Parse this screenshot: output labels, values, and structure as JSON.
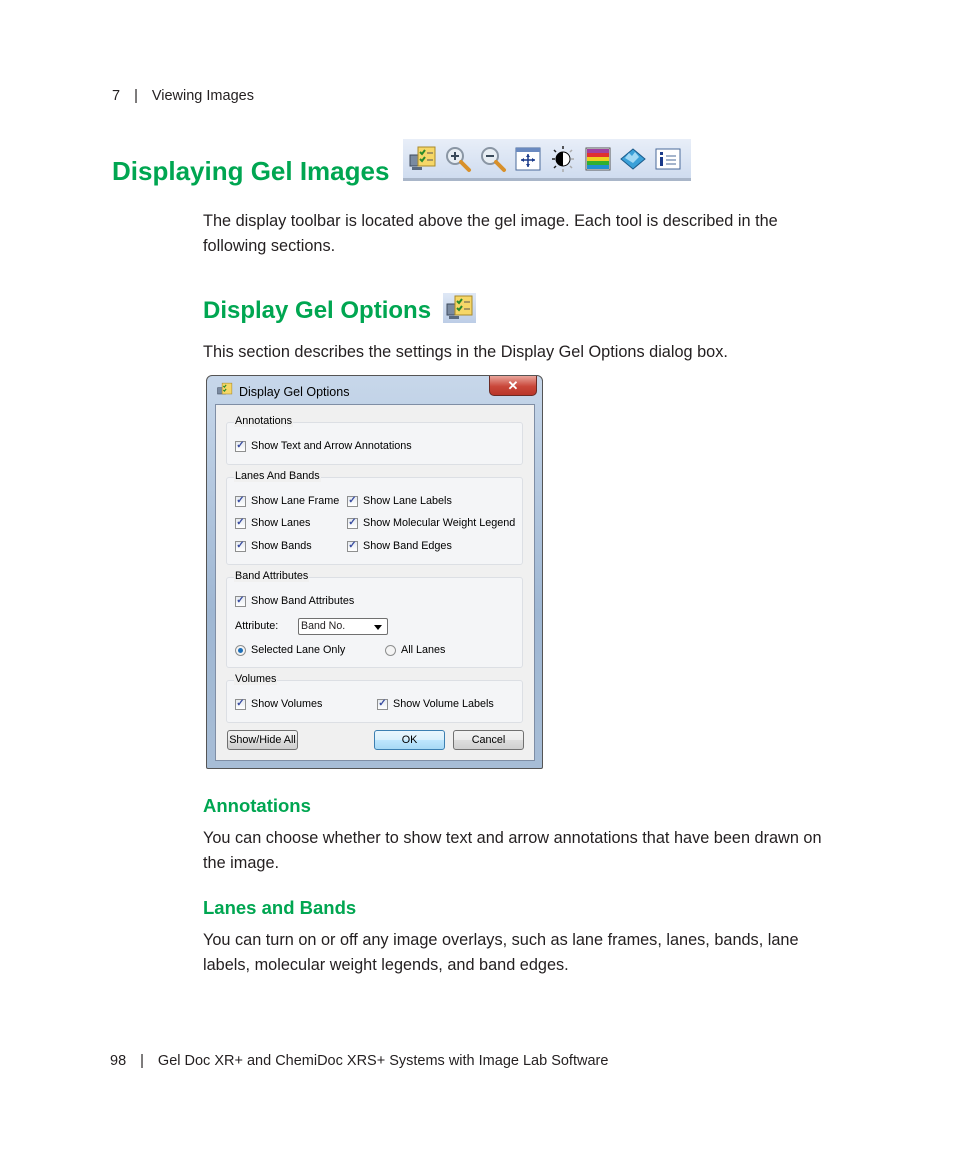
{
  "header": {
    "chapter_number": "7",
    "separator": "|",
    "chapter_title": "Viewing Images"
  },
  "section": {
    "title": "Displaying Gel Images",
    "toolbar_icons": [
      "display-gel-options-icon",
      "zoom-in-icon",
      "zoom-out-icon",
      "fit-in-window-icon",
      "image-transform-icon",
      "color-palette-icon",
      "3d-viewer-icon",
      "image-info-icon"
    ],
    "intro": "The display toolbar is located above the gel image. Each tool is described in the following sections."
  },
  "subsection": {
    "title": "Display Gel Options",
    "icon": "display-gel-options-icon",
    "intro": "This section describes the settings in the Display Gel Options dialog box."
  },
  "dialog": {
    "title": "Display Gel Options",
    "close_label": "✕",
    "groups": {
      "annotations": {
        "label": "Annotations",
        "items": [
          {
            "label": "Show Text and Arrow Annotations",
            "checked": true
          }
        ]
      },
      "lanes_and_bands": {
        "label": "Lanes And Bands",
        "items": [
          {
            "label": "Show Lane Frame",
            "checked": true
          },
          {
            "label": "Show Lane Labels",
            "checked": true
          },
          {
            "label": "Show Lanes",
            "checked": true
          },
          {
            "label": "Show Molecular Weight Legend",
            "checked": true
          },
          {
            "label": "Show Bands",
            "checked": true
          },
          {
            "label": "Show Band Edges",
            "checked": true
          }
        ]
      },
      "band_attributes": {
        "label": "Band Attributes",
        "show_label": "Show Band Attributes",
        "show_checked": true,
        "attribute_label": "Attribute:",
        "attribute_value": "Band No.",
        "radio_selected_lane": "Selected Lane Only",
        "radio_all_lanes": "All Lanes",
        "selected_radio": "Selected Lane Only"
      },
      "volumes": {
        "label": "Volumes",
        "items": [
          {
            "label": "Show Volumes",
            "checked": true
          },
          {
            "label": "Show Volume Labels",
            "checked": true
          }
        ]
      }
    },
    "buttons": {
      "show_hide_all": "Show/Hide All",
      "ok": "OK",
      "cancel": "Cancel"
    }
  },
  "annotations_section": {
    "title": "Annotations",
    "body": "You can choose whether to show text and arrow annotations that have been drawn on the image."
  },
  "lanes_section": {
    "title": "Lanes and Bands",
    "body": "You can turn on or off any image overlays, such as lane frames, lanes, bands, lane labels, molecular weight legends, and band edges."
  },
  "footer": {
    "page_number": "98",
    "separator": "|",
    "book_title": "Gel Doc XR+ and ChemiDoc XRS+ Systems with Image Lab Software"
  },
  "colors": {
    "heading_green": "#00a651",
    "text": "#231f20"
  }
}
